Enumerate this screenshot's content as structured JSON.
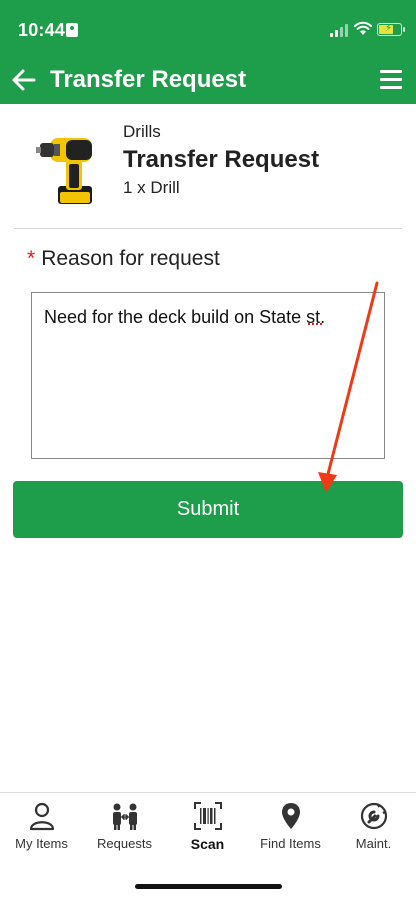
{
  "status_bar": {
    "time": "10:44"
  },
  "header": {
    "title": "Transfer Request"
  },
  "product": {
    "category": "Drills",
    "title": "Transfer Request",
    "quantity": "1 x Drill"
  },
  "form": {
    "required_marker": "*",
    "reason_label": "Reason for request",
    "reason_value": "Need for the deck build on State st.",
    "submit_label": "Submit"
  },
  "tabs": [
    {
      "label": "My Items",
      "icon": "person-icon"
    },
    {
      "label": "Requests",
      "icon": "people-exchange-icon"
    },
    {
      "label": "Scan",
      "icon": "barcode-scan-icon",
      "active": true
    },
    {
      "label": "Find Items",
      "icon": "map-pin-icon"
    },
    {
      "label": "Maint.",
      "icon": "wrench-circle-icon"
    }
  ],
  "colors": {
    "brand_green": "#1e9e4a",
    "required_red": "#e21b1b",
    "annotation_arrow": "#f03a17"
  }
}
